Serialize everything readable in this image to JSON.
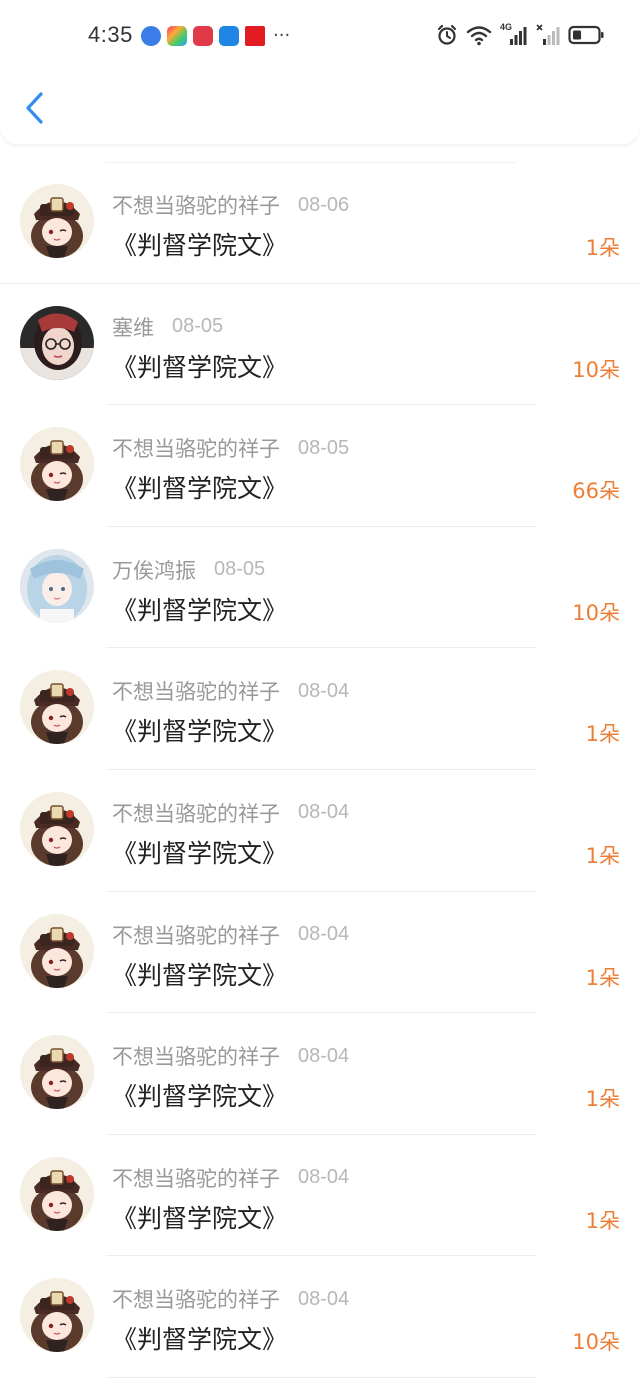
{
  "status_bar": {
    "time": "4:35",
    "more": "···",
    "network": "4G",
    "notification_icons": [
      "browser-icon",
      "app-store-icon",
      "reader-icon",
      "weather-icon",
      "app-icon"
    ],
    "system_icons": [
      "alarm-icon",
      "wifi-icon",
      "signal-icon",
      "signal-icon",
      "battery-icon"
    ],
    "battery_level": 0.35
  },
  "header": {
    "back_icon": "chevron-left-icon",
    "accent_color": "#2f8ef0"
  },
  "colors": {
    "amount": "#ee7d36",
    "name": "#999999",
    "date": "#b7b7b7",
    "title": "#222222"
  },
  "rows": [
    {
      "name": "不想当骆驼的祥子",
      "date": "08-06",
      "title": "《判督学院文》",
      "amount": "1朵",
      "avatar": "hutao-avatar"
    },
    {
      "name": "塞维",
      "date": "08-05",
      "title": "《判督学院文》",
      "amount": "10朵",
      "avatar": "glasses-girl-avatar"
    },
    {
      "name": "不想当骆驼的祥子",
      "date": "08-05",
      "title": "《判督学院文》",
      "amount": "66朵",
      "avatar": "hutao-avatar"
    },
    {
      "name": "万俟鸿振",
      "date": "08-05",
      "title": "《判督学院文》",
      "amount": "10朵",
      "avatar": "anime-girl-avatar"
    },
    {
      "name": "不想当骆驼的祥子",
      "date": "08-04",
      "title": "《判督学院文》",
      "amount": "1朵",
      "avatar": "hutao-avatar"
    },
    {
      "name": "不想当骆驼的祥子",
      "date": "08-04",
      "title": "《判督学院文》",
      "amount": "1朵",
      "avatar": "hutao-avatar"
    },
    {
      "name": "不想当骆驼的祥子",
      "date": "08-04",
      "title": "《判督学院文》",
      "amount": "1朵",
      "avatar": "hutao-avatar"
    },
    {
      "name": "不想当骆驼的祥子",
      "date": "08-04",
      "title": "《判督学院文》",
      "amount": "1朵",
      "avatar": "hutao-avatar"
    },
    {
      "name": "不想当骆驼的祥子",
      "date": "08-04",
      "title": "《判督学院文》",
      "amount": "1朵",
      "avatar": "hutao-avatar"
    },
    {
      "name": "不想当骆驼的祥子",
      "date": "08-04",
      "title": "《判督学院文》",
      "amount": "10朵",
      "avatar": "hutao-avatar"
    }
  ]
}
